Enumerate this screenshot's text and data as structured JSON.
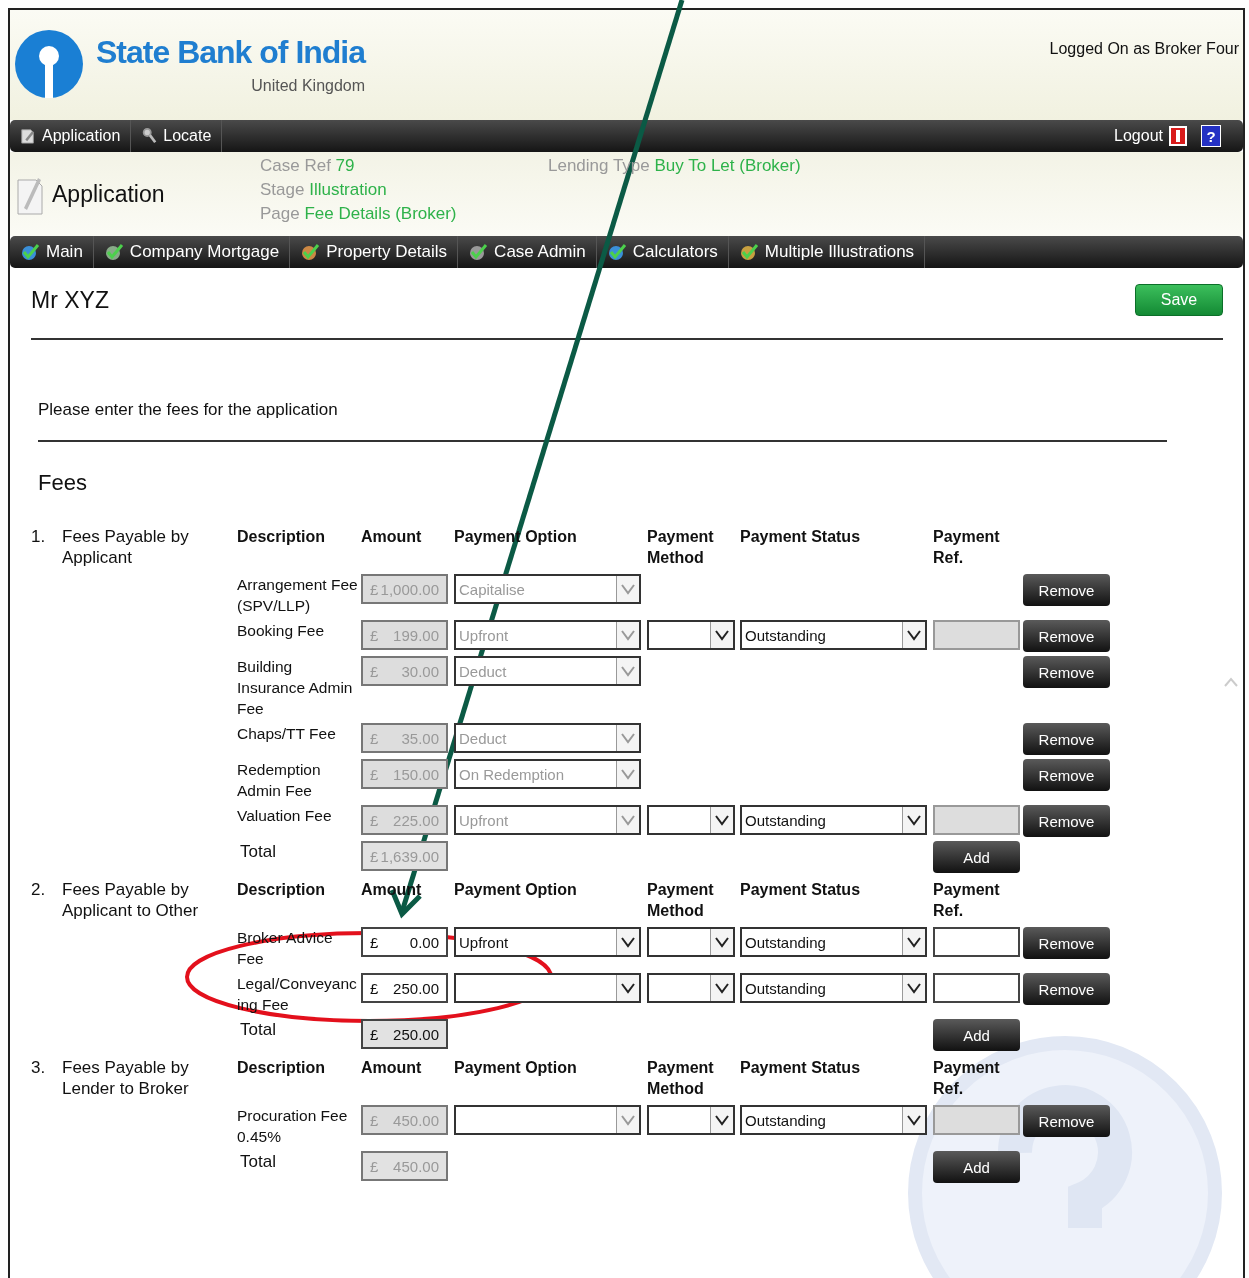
{
  "header": {
    "bank_name": "State Bank of India",
    "region": "United Kingdom",
    "user_status": "Logged On as Broker Four"
  },
  "top_menu": {
    "items": [
      {
        "label": "Application"
      },
      {
        "label": "Locate"
      }
    ],
    "logout_label": "Logout",
    "help_label": "?"
  },
  "case": {
    "title": "Application",
    "details": [
      {
        "label": "Case Ref",
        "value": "79"
      },
      {
        "label": "Stage",
        "value": "Illustration"
      },
      {
        "label": "Page",
        "value": "Fee Details (Broker)"
      }
    ],
    "lending_type": {
      "label": "Lending Type",
      "value": "Buy To Let (Broker)"
    }
  },
  "tabs": [
    {
      "label": "Main"
    },
    {
      "label": "Company Mortgage"
    },
    {
      "label": "Property Details"
    },
    {
      "label": "Case Admin"
    },
    {
      "label": "Calculators"
    },
    {
      "label": "Multiple Illustrations"
    }
  ],
  "customer_name": "Mr XYZ",
  "save_label": "Save",
  "instruction": "Please enter the fees for the application",
  "section_title": "Fees",
  "fee_groups": [
    {
      "number": "1.",
      "title": "Fees Payable by Applicant",
      "columns": [
        "Description",
        "Amount",
        "Payment Option",
        "Payment Method",
        "Payment Status",
        "Payment Ref."
      ],
      "rows": [
        {
          "description": "Arrangement Fee (SPV/LLP)",
          "currency": "£",
          "amount": "1,000.00",
          "locked": true,
          "payment_option": "Capitalise",
          "remove_label": "Remove"
        },
        {
          "description": "Booking Fee",
          "currency": "£",
          "amount": "199.00",
          "locked": true,
          "payment_option": "Upfront",
          "payment_status": "Outstanding",
          "remove_label": "Remove"
        },
        {
          "description": "Building Insurance Admin Fee",
          "currency": "£",
          "amount": "30.00",
          "locked": true,
          "payment_option": "Deduct",
          "remove_label": "Remove"
        },
        {
          "description": "Chaps/TT Fee",
          "currency": "£",
          "amount": "35.00",
          "locked": true,
          "payment_option": "Deduct",
          "remove_label": "Remove"
        },
        {
          "description": "Redemption Admin Fee",
          "currency": "£",
          "amount": "150.00",
          "locked": true,
          "payment_option": "On Redemption",
          "remove_label": "Remove"
        },
        {
          "description": "Valuation Fee",
          "currency": "£",
          "amount": "225.00",
          "locked": true,
          "payment_option": "Upfront",
          "payment_status": "Outstanding",
          "remove_label": "Remove"
        }
      ],
      "total": {
        "label": "Total",
        "currency": "£",
        "amount": "1,639.00",
        "locked": true
      },
      "add_label": "Add"
    },
    {
      "number": "2.",
      "title": "Fees Payable by Applicant to Other",
      "columns": [
        "Description",
        "Amount",
        "Payment Option",
        "Payment Method",
        "Payment Status",
        "Payment Ref."
      ],
      "rows": [
        {
          "description": "Broker Advice Fee",
          "currency": "£",
          "amount": "0.00",
          "locked": false,
          "payment_option": "Upfront",
          "payment_status": "Outstanding",
          "remove_label": "Remove"
        },
        {
          "description": "Legal/Conveyancing Fee",
          "currency": "£",
          "amount": "250.00",
          "locked": false,
          "payment_status": "Outstanding",
          "remove_label": "Remove"
        }
      ],
      "total": {
        "label": "Total",
        "currency": "£",
        "amount": "250.00",
        "locked": false
      },
      "add_label": "Add"
    },
    {
      "number": "3.",
      "title": "Fees Payable by Lender to Broker",
      "columns": [
        "Description",
        "Amount",
        "Payment Option",
        "Payment Method",
        "Payment Status",
        "Payment Ref."
      ],
      "rows": [
        {
          "description": "Procuration Fee 0.45%",
          "currency": "£",
          "amount": "450.00",
          "locked": true,
          "payment_status": "Outstanding",
          "remove_label": "Remove"
        }
      ],
      "total": {
        "label": "Total",
        "currency": "£",
        "amount": "450.00",
        "locked": true
      },
      "add_label": "Add"
    }
  ]
}
